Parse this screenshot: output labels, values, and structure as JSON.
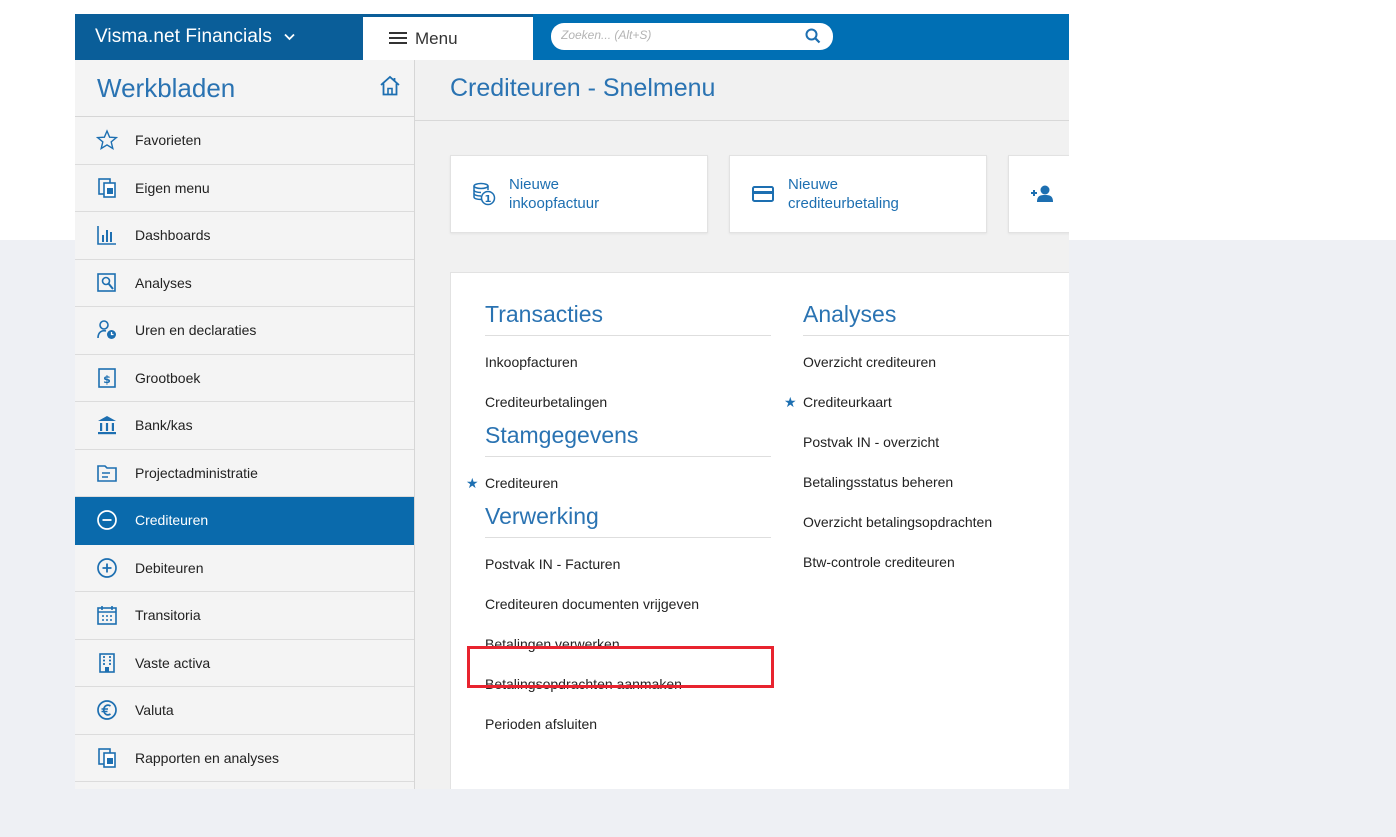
{
  "app": {
    "brand": "Visma.net Financials",
    "menu_label": "Menu",
    "search_placeholder": "Zoeken... (Alt+S)"
  },
  "sidebar": {
    "title": "Werkbladen",
    "items": [
      {
        "label": "Favorieten",
        "icon": "star-icon"
      },
      {
        "label": "Eigen menu",
        "icon": "document-icon"
      },
      {
        "label": "Dashboards",
        "icon": "bar-chart-icon"
      },
      {
        "label": "Analyses",
        "icon": "analysis-icon"
      },
      {
        "label": "Uren en declaraties",
        "icon": "person-clock-icon"
      },
      {
        "label": "Grootboek",
        "icon": "ledger-icon"
      },
      {
        "label": "Bank/kas",
        "icon": "bank-icon"
      },
      {
        "label": "Projectadministratie",
        "icon": "folder-icon"
      },
      {
        "label": "Crediteuren",
        "icon": "minus-circle-icon",
        "active": true
      },
      {
        "label": "Debiteuren",
        "icon": "plus-circle-icon"
      },
      {
        "label": "Transitoria",
        "icon": "calendar-icon"
      },
      {
        "label": "Vaste activa",
        "icon": "building-icon"
      },
      {
        "label": "Valuta",
        "icon": "euro-icon"
      },
      {
        "label": "Rapporten en analyses",
        "icon": "report-icon"
      }
    ]
  },
  "main": {
    "title": "Crediteuren - Snelmenu",
    "tiles": [
      {
        "label": "Nieuwe inkoopfactuur",
        "icon": "coins-icon"
      },
      {
        "label": "Nieuwe crediteurbetaling",
        "icon": "card-icon"
      },
      {
        "label": "",
        "icon": "add-person-icon"
      }
    ],
    "sections": {
      "transacties": {
        "title": "Transacties",
        "links": [
          "Inkoopfacturen",
          "Crediteurbetalingen"
        ]
      },
      "stamgegevens": {
        "title": "Stamgegevens",
        "links": [
          "Crediteuren"
        ]
      },
      "verwerking": {
        "title": "Verwerking",
        "links": [
          "Postvak IN - Facturen",
          "Crediteuren documenten vrijgeven",
          "Betalingen verwerken",
          "Betalingsopdrachten aanmaken",
          "Perioden afsluiten"
        ]
      },
      "analyses": {
        "title": "Analyses",
        "links": [
          "Overzicht crediteuren",
          "Crediteurkaart",
          "Postvak IN - overzicht",
          "Betalingsstatus beheren",
          "Overzicht betalingsopdrachten",
          "Btw-controle crediteuren"
        ]
      }
    }
  },
  "colors": {
    "brand": "#0a5e99",
    "topbar": "#006fb4",
    "accent": "#2a73b2",
    "highlight": "#e8232f"
  }
}
